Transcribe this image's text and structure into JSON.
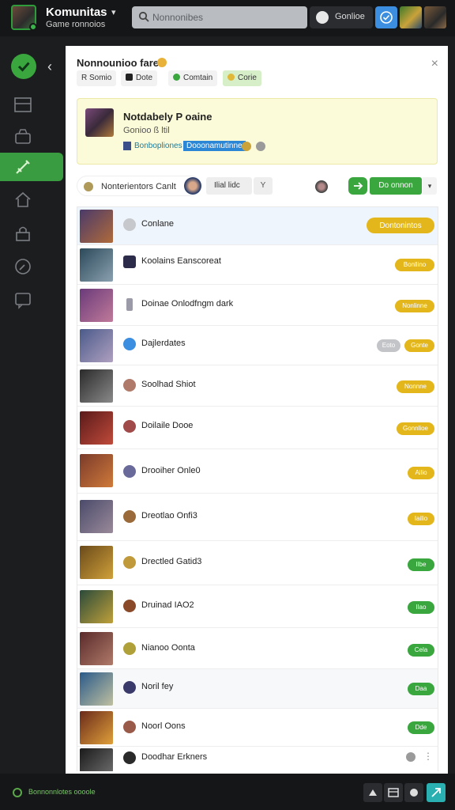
{
  "app": {
    "title": "Komunitas",
    "subtitle": "Game ronnoios",
    "caret": "▾"
  },
  "search": {
    "placeholder": "Nonnonibes"
  },
  "user_chip": {
    "name": "Gonlioe"
  },
  "sidebar": {
    "back": "‹",
    "items": [
      "home",
      "board",
      "box",
      "sword",
      "hut",
      "lock",
      "compass",
      "chat"
    ]
  },
  "panel": {
    "title": "Nonnounioo fare",
    "close": "×",
    "tags": [
      {
        "label": "R Somio",
        "dot": ""
      },
      {
        "label": "Dote",
        "dot": "#222"
      },
      {
        "label": "Comtain",
        "dot": "#3aa63e"
      },
      {
        "label": "Corie",
        "dot": "#e0b83a"
      }
    ],
    "feature": {
      "title": "Notdabely P oaine",
      "subtitle": "Gonioo ß ltil",
      "meta_link": "Bonbopliones",
      "meta_tag": "Dooonamutinne"
    },
    "toolbar": {
      "sort_label": "Nonterientors Canlt",
      "filter_label": "Ilial lidc",
      "filter_mini": "Y",
      "cta_label": "Do onnon",
      "more": "▾"
    }
  },
  "rows": [
    {
      "label": "Conlane",
      "badge": "Dontonintos",
      "badge_color": "#e3b71c",
      "icon_color": "#c6c8cc",
      "highlight": true,
      "thumb": [
        "#4a3a6a",
        "#b06a3a"
      ]
    },
    {
      "label": "Koolains Eanscoreat",
      "badge": "Bonllino",
      "badge_color": "#e3b71c",
      "icon_color": "#2c2c4a",
      "thumb": [
        "#2c4a5a",
        "#8aa0b0"
      ]
    },
    {
      "label": "Doinae Onlodfngm dark",
      "badge": "Nonlinne",
      "badge_color": "#e3b71c",
      "icon_color": "#9a9aa8",
      "thumb": [
        "#6a3a7a",
        "#c07a9a"
      ]
    },
    {
      "label": "Dajlerdates",
      "badge": "Gonte",
      "badge_color": "#e3b71c",
      "badge_extra": "Eoto",
      "badge_extra_color": "#c2c4c8",
      "icon_color": "#3b8ee0",
      "thumb": [
        "#4a5a8a",
        "#b0a0c0"
      ]
    },
    {
      "label": "Soolhad Shiot",
      "badge": "Nonnne",
      "badge_color": "#e3b71c",
      "icon_color": "#b07a6a",
      "thumb": [
        "#2a2a2a",
        "#8a8a8a"
      ]
    },
    {
      "label": "Doilaile Dooe",
      "badge": "Gonnlioe",
      "badge_color": "#e3b71c",
      "icon_color": "#a04a4a",
      "thumb": [
        "#5a1a1a",
        "#c04a3a"
      ]
    },
    {
      "label": "Drooiher Onle0",
      "badge": "Ailio",
      "badge_color": "#e3b71c",
      "icon_color": "#6a6a9a",
      "thumb": [
        "#7a3a2a",
        "#d07a3a"
      ]
    },
    {
      "label": "Dreotlao Onfi3",
      "badge": "Iailio",
      "badge_color": "#e3b71c",
      "icon_color": "#9a6a3a",
      "thumb": [
        "#4a4a6a",
        "#9a8a9a"
      ]
    },
    {
      "label": "Drectled Gatid3",
      "badge": "Ilbe",
      "badge_color": "#3aa63e",
      "icon_color": "#c09a3a",
      "thumb": [
        "#6a4a1a",
        "#d0a03a"
      ]
    },
    {
      "label": "Druinad IAO2",
      "badge": "Ilao",
      "badge_color": "#3aa63e",
      "icon_color": "#8a4a2a",
      "thumb": [
        "#2a4a3a",
        "#c0a03a"
      ]
    },
    {
      "label": "Nianoo Oonta",
      "badge": "Cela",
      "badge_color": "#3aa63e",
      "icon_color": "#b0a03a",
      "thumb": [
        "#5a2a2a",
        "#b07a6a"
      ]
    },
    {
      "label": "Noril fey",
      "badge": "Daa",
      "badge_color": "#3aa63e",
      "icon_color": "#3a3a6a",
      "thumb": [
        "#2a5a8a",
        "#c0c0a0"
      ]
    },
    {
      "label": "Noorl Oons",
      "badge": "Dde",
      "badge_color": "#3aa63e",
      "icon_color": "#9a5a4a",
      "thumb": [
        "#6a2a1a",
        "#e0a03a"
      ]
    },
    {
      "label": "Doodhar Erkners",
      "badge": "",
      "badge_color": "",
      "icon_color": "#2a2a2a",
      "thumb": [
        "#1a1a1a",
        "#6a6a6a"
      ],
      "trailing": "⋮"
    }
  ],
  "footer": {
    "label": "Bonnonnlotes oooole"
  }
}
